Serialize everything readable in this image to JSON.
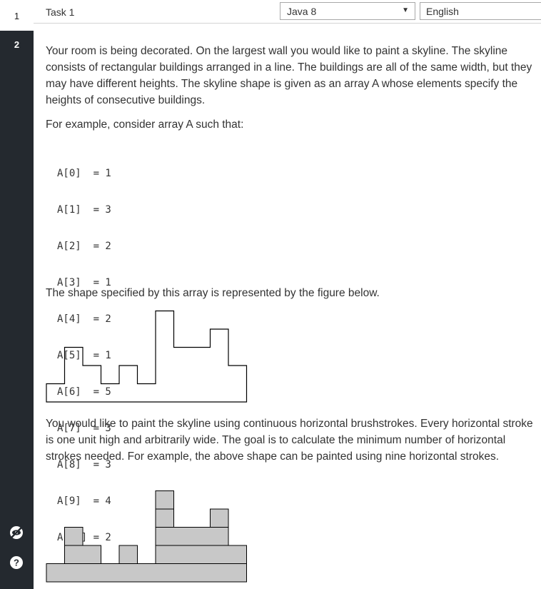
{
  "sidebar": {
    "tasks": [
      "1",
      "2"
    ],
    "icons": [
      "eye-slash-icon",
      "help-icon"
    ]
  },
  "header": {
    "task_title": "Task 1",
    "language": "Java 8",
    "locale": "English"
  },
  "problem": {
    "paragraph1": "Your room is being decorated. On the largest wall you would like to paint a skyline. The skyline consists of rectangular buildings arranged in a line. The buildings are all of the same width, but they may have different heights. The skyline shape is given as an array A whose elements specify the heights of consecutive buildings.",
    "paragraph2": "For example, consider array A such that:",
    "array_lines": [
      "A[0]  = 1",
      "A[1]  = 3",
      "A[2]  = 2",
      "A[3]  = 1",
      "A[4]  = 2",
      "A[5]  = 1",
      "A[6]  = 5",
      "A[7]  = 3",
      "A[8]  = 3",
      "A[9]  = 4",
      "A[10] = 2"
    ],
    "paragraph3": "The shape specified by this array is represented by the figure below.",
    "paragraph4": "You would like to paint the skyline using continuous horizontal brushstrokes. Every horizontal stroke is one unit high and arbitrarily wide. The goal is to calculate the minimum number of horizontal strokes needed. For example, the above shape can be painted using nine horizontal strokes."
  },
  "skyline_heights": [
    1,
    3,
    2,
    1,
    2,
    1,
    5,
    3,
    3,
    4,
    2
  ],
  "colors": {
    "sidebar": "#24292f",
    "stroke_fill": "#c8c8c8",
    "outline": "#000000"
  }
}
